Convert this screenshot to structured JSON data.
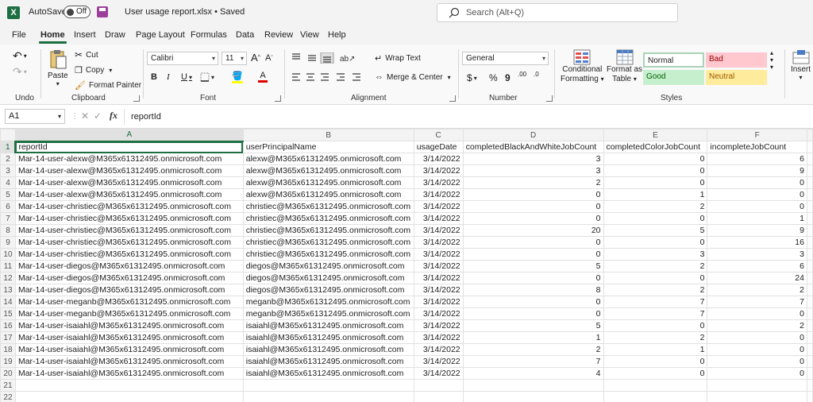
{
  "titlebar": {
    "autosave_label": "AutoSave",
    "autosave_state": "Off",
    "doc_title": "User usage report.xlsx • Saved",
    "search_placeholder": "Search (Alt+Q)"
  },
  "menu": {
    "tabs": [
      "File",
      "Home",
      "Insert",
      "Draw",
      "Page Layout",
      "Formulas",
      "Data",
      "Review",
      "View",
      "Help"
    ],
    "active": "Home"
  },
  "ribbon": {
    "undo": {
      "label": "Undo"
    },
    "clipboard": {
      "label": "Clipboard",
      "paste": "Paste",
      "cut": "Cut",
      "copy": "Copy",
      "format_painter": "Format Painter"
    },
    "font": {
      "label": "Font",
      "family": "Calibri",
      "size": "11",
      "grow": "A",
      "shrink": "A",
      "bold": "B",
      "italic": "I",
      "underline": "U",
      "font_color_letter": "A"
    },
    "alignment": {
      "label": "Alignment",
      "wrap_text": "Wrap Text",
      "merge_center": "Merge & Center"
    },
    "number": {
      "label": "Number",
      "format": "General",
      "currency": "$",
      "percent": "%",
      "comma": "9",
      "inc_dec": ".00",
      "dec_dec": ".0"
    },
    "styles": {
      "label": "Styles",
      "conditional_formatting_1": "Conditional",
      "conditional_formatting_2": "Formatting",
      "format_as_table_1": "Format as",
      "format_as_table_2": "Table",
      "normal": "Normal",
      "bad": "Bad",
      "good": "Good",
      "neutral": "Neutral",
      "colors": {
        "bad_bg": "#ffc7ce",
        "bad_fg": "#9c0006",
        "good_bg": "#c6efce",
        "good_fg": "#006100",
        "neutral_bg": "#ffeb9c",
        "neutral_fg": "#9c5700"
      }
    },
    "cells": {
      "insert": "Insert"
    }
  },
  "formula_bar": {
    "name_box": "A1",
    "fx": "fx",
    "formula": "reportId"
  },
  "sheet": {
    "columns": [
      "A",
      "B",
      "C",
      "D",
      "E",
      "F"
    ],
    "headers": [
      "reportId",
      "userPrincipalName",
      "usageDate",
      "completedBlackAndWhiteJobCount",
      "completedColorJobCount",
      "incompleteJobCount"
    ],
    "rows": [
      [
        "Mar-14-user-alexw@M365x61312495.onmicrosoft.com",
        "alexw@M365x61312495.onmicrosoft.com",
        "3/14/2022",
        "3",
        "0",
        "6"
      ],
      [
        "Mar-14-user-alexw@M365x61312495.onmicrosoft.com",
        "alexw@M365x61312495.onmicrosoft.com",
        "3/14/2022",
        "3",
        "0",
        "9"
      ],
      [
        "Mar-14-user-alexw@M365x61312495.onmicrosoft.com",
        "alexw@M365x61312495.onmicrosoft.com",
        "3/14/2022",
        "2",
        "0",
        "0"
      ],
      [
        "Mar-14-user-alexw@M365x61312495.onmicrosoft.com",
        "alexw@M365x61312495.onmicrosoft.com",
        "3/14/2022",
        "0",
        "1",
        "0"
      ],
      [
        "Mar-14-user-christiec@M365x61312495.onmicrosoft.com",
        "christiec@M365x61312495.onmicrosoft.com",
        "3/14/2022",
        "0",
        "2",
        "0"
      ],
      [
        "Mar-14-user-christiec@M365x61312495.onmicrosoft.com",
        "christiec@M365x61312495.onmicrosoft.com",
        "3/14/2022",
        "0",
        "0",
        "1"
      ],
      [
        "Mar-14-user-christiec@M365x61312495.onmicrosoft.com",
        "christiec@M365x61312495.onmicrosoft.com",
        "3/14/2022",
        "20",
        "5",
        "9"
      ],
      [
        "Mar-14-user-christiec@M365x61312495.onmicrosoft.com",
        "christiec@M365x61312495.onmicrosoft.com",
        "3/14/2022",
        "0",
        "0",
        "16"
      ],
      [
        "Mar-14-user-christiec@M365x61312495.onmicrosoft.com",
        "christiec@M365x61312495.onmicrosoft.com",
        "3/14/2022",
        "0",
        "3",
        "3"
      ],
      [
        "Mar-14-user-diegos@M365x61312495.onmicrosoft.com",
        "diegos@M365x61312495.onmicrosoft.com",
        "3/14/2022",
        "5",
        "2",
        "6"
      ],
      [
        "Mar-14-user-diegos@M365x61312495.onmicrosoft.com",
        "diegos@M365x61312495.onmicrosoft.com",
        "3/14/2022",
        "0",
        "0",
        "24"
      ],
      [
        "Mar-14-user-diegos@M365x61312495.onmicrosoft.com",
        "diegos@M365x61312495.onmicrosoft.com",
        "3/14/2022",
        "8",
        "2",
        "2"
      ],
      [
        "Mar-14-user-meganb@M365x61312495.onmicrosoft.com",
        "meganb@M365x61312495.onmicrosoft.com",
        "3/14/2022",
        "0",
        "7",
        "7"
      ],
      [
        "Mar-14-user-meganb@M365x61312495.onmicrosoft.com",
        "meganb@M365x61312495.onmicrosoft.com",
        "3/14/2022",
        "0",
        "7",
        "0"
      ],
      [
        "Mar-14-user-isaiahl@M365x61312495.onmicrosoft.com",
        "isaiahl@M365x61312495.onmicrosoft.com",
        "3/14/2022",
        "5",
        "0",
        "2"
      ],
      [
        "Mar-14-user-isaiahl@M365x61312495.onmicrosoft.com",
        "isaiahl@M365x61312495.onmicrosoft.com",
        "3/14/2022",
        "1",
        "2",
        "0"
      ],
      [
        "Mar-14-user-isaiahl@M365x61312495.onmicrosoft.com",
        "isaiahl@M365x61312495.onmicrosoft.com",
        "3/14/2022",
        "2",
        "1",
        "0"
      ],
      [
        "Mar-14-user-isaiahl@M365x61312495.onmicrosoft.com",
        "isaiahl@M365x61312495.onmicrosoft.com",
        "3/14/2022",
        "7",
        "0",
        "0"
      ],
      [
        "Mar-14-user-isaiahl@M365x61312495.onmicrosoft.com",
        "isaiahl@M365x61312495.onmicrosoft.com",
        "3/14/2022",
        "4",
        "0",
        "0"
      ]
    ],
    "empty_rows": [
      "21",
      "22"
    ]
  }
}
